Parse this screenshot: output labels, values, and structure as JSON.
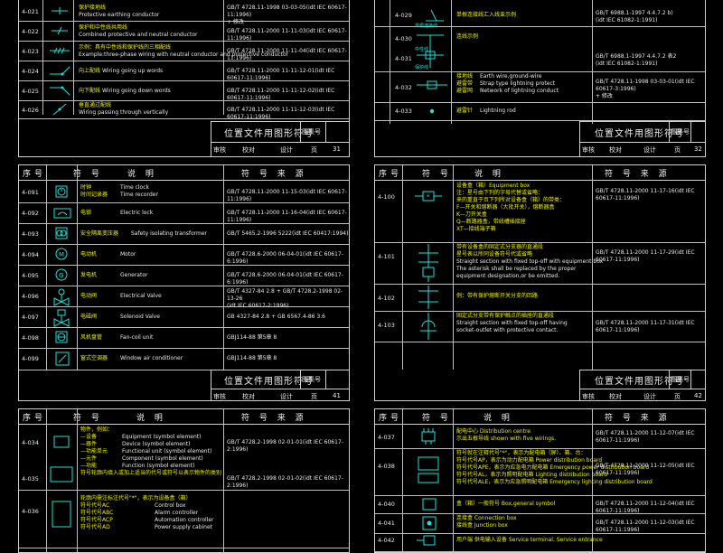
{
  "sheets": {
    "s31": {
      "rows": [
        {
          "num": "4-021",
          "cn": "保护接地线",
          "en": "Protective earthing conductor",
          "src": "GB/T 4728.11-1998 03-03-05(idt IEC 60617-11:1996)",
          "src2": "+ 修改"
        },
        {
          "num": "4-022",
          "cn": "保护和中性线共用线",
          "en": "Combined protective and neutral conductor",
          "src": "GB/T 4728.11-2000 11-11-03(idt IEC 60617-11:1996)"
        },
        {
          "num": "4-023",
          "cn": "示例：具有中性线和保护线的三相配线",
          "en": "Example:three-phase wiring with neutral conductor and protective conductor",
          "src": "GB/T 4728.11-2000 11-11-04(idt IEC 60617-11:1996)"
        },
        {
          "num": "4-024",
          "cn": "向上配线",
          "en": "Wiring going up words",
          "src": "GB/T 4728.11-2000 11-11-12-01(idt IEC 60617-11:1996)"
        },
        {
          "num": "4-025",
          "cn": "向下配线",
          "en": "Wiring going down words",
          "src": "GB/T 4728.11-2000 11-11-12-02(idt IEC 60617-11:1996)"
        },
        {
          "num": "4-026",
          "cn": "垂直通过配线",
          "en": "Wiring passing through vertically",
          "src": "GB/T 4728.11-2000 11-11-12-03(idt IEC 60617-11:1996)"
        }
      ],
      "title": "位置文件用图形符号",
      "label": "图集号",
      "page": "31",
      "b1": "审核",
      "b2": "校对",
      "b3": "设计",
      "b4": "页"
    },
    "s32": {
      "rows": [
        {
          "num": "4-029",
          "cn": "单根连接线汇入线束示例",
          "en": "",
          "src": "GB/T 6988.1-1997 4.4.7.2 b)",
          "src2": "(idt IEC 61082-1:1991)"
        },
        {
          "num": "4-030",
          "cn": "",
          "en": "",
          "src": ""
        },
        {
          "num": "4-031",
          "cn": "",
          "en": "",
          "src": "GB/T 6988.1-1997 4.4.7.2 表2",
          "src2": "(idt IEC 61082-1:1991)"
        },
        {
          "num": "4-032",
          "cn": "接地线",
          "en": "Earth wire,ground-wire",
          "cn2": "避雷带",
          "en2": "Strap type lightning protect",
          "cn3": "避雷网",
          "en3": "Network of lightning conduct",
          "src": "GB/T 4728.11-1998 03-03-01(idt IEC 60617-3:1996)",
          "src2": "+ 修改"
        },
        {
          "num": "4-033",
          "cn": "避雷针",
          "en": "Lightning rod",
          "src": ""
        }
      ],
      "label_a": "单根连接线",
      "label_b": "连线示例",
      "label_c": "中性线",
      "label_d": "保护线",
      "title": "位置文件用图形符号",
      "label": "图集号",
      "page": "32",
      "b1": "审核",
      "b2": "校对",
      "b3": "设计",
      "b4": "页"
    },
    "s41": {
      "header": {
        "c1": "序号",
        "c2": "符 号",
        "c3": "说 明",
        "c4": "符 号 来 源"
      },
      "rows": [
        {
          "num": "4-091",
          "cn": "时钟",
          "en": "Time clock",
          "cn2": "时间记录器",
          "en2": "Time recorder",
          "src": "GB/T 4728.11-2000 11-15-03(idt IEC 60617-11:1996)"
        },
        {
          "num": "4-092",
          "cn": "电锁",
          "en": "Electric lock",
          "src": "GB/T 4728.11-2000 11-16-04(idt IEC 60617-11:1996)"
        },
        {
          "num": "4-093",
          "cn": "安全隔离变压器",
          "en": "Safety isolating transformer",
          "src": "GB/T 5465.2-1996 5222(idt IEC 60417:1994)"
        },
        {
          "num": "4-094",
          "cn": "电动机",
          "en": "Motor",
          "src": "GB/T 4728.6-2000 06-04-01(idt IEC 60617-6:1996)"
        },
        {
          "num": "4-095",
          "cn": "发电机",
          "en": "Generator",
          "src": "GB/T 4728.6-2000 06-04-01(idt IEC 60617-6:1996)"
        },
        {
          "num": "4-096",
          "cn": "电动阀",
          "en": "Electrical Valve",
          "src": "GB/T 4327-84 2.8 + GB/T 4728.2-1998 02-13-26",
          "src2": "(idt IEC 60617-2:1996)"
        },
        {
          "num": "4-097",
          "cn": "电磁阀",
          "en": "Solenoid Valve",
          "src": "GB 4327-84 2.8 + GB 6567.4-86 3.6"
        },
        {
          "num": "4-098",
          "cn": "风机盘管",
          "en": "Fan-coil unit",
          "src": "GBJ114-88 第5章 8"
        },
        {
          "num": "4-099",
          "cn": "窗式空调器",
          "en": "Window air conditioner",
          "src": "GBJ114-88 第5章 8"
        }
      ],
      "title": "位置文件用图形符号",
      "label": "图集号",
      "page": "41",
      "b1": "审核",
      "b2": "校对",
      "b3": "设计",
      "b4": "页"
    },
    "s42": {
      "header": {
        "c1": "序号",
        "c2": "符 号",
        "c3": "说 明",
        "c4": "符 号 来 源"
      },
      "rows": [
        {
          "num": "4-100",
          "lines": [
            "设备盒（箱）Equipment box",
            "注：星号由下列的字母代替或省略：",
            "来的重直于页下列所对设备盒（箱）的带类：",
            "F—开关和熔断器（大批开关），熔断器盒",
            "K—刀开关盒",
            "Q—断路器盒，带线槽插接座",
            "XT—接线端子箱"
          ],
          "src": "GB/T 4728.11-2000 11-17-16(idt IEC 60617-11:1996)"
        },
        {
          "num": "4-101",
          "lines": [
            "带有设备盒的固定式分支器的直通段",
            "星号表以所同设备符号代或省略",
            "Straight section with fixed top-off with equipment box",
            "The asterisk shall be replaced by the proper",
            "equipment designation,or be omitted."
          ],
          "src": "GB/T 4728.11-2000 11-17-29(idt IEC 60617-11:1996)"
        },
        {
          "num": "4-102",
          "lines": [
            "例：带有保护熔断开关分支的回路"
          ],
          "src": ""
        },
        {
          "num": "4-103",
          "lines": [
            "固定式分支带有保护触点的插座的直通段",
            "Straight section with fixed top-off having",
            "socket-outlet with protective contact."
          ],
          "src": "GB/T 4728.11-2000 11-17-31(idt IEC 60617-11:1996)"
        }
      ],
      "title": "位置文件用图形符号",
      "label": "图集号",
      "page": "42",
      "b1": "审核",
      "b2": "校对",
      "b3": "设计",
      "b4": "页"
    },
    "s51": {
      "header": {
        "c1": "序号",
        "c2": "符 号",
        "c3": "说 明",
        "c4": "符 号 来 源"
      },
      "rows": [
        {
          "num": "4-034",
          "lines": [
            "物件，例如：",
            "—设备",
            "—器件",
            "—功能单元",
            "—元件",
            "—功能"
          ],
          "en": [
            "",
            "Equipment (symbol element)",
            "Device (symbol element)",
            "Functional unit (symbol element)",
            "Component (symbol element)",
            "Function (symbol element)"
          ],
          "tail": "符号轮廓内填入或加上适当的代号或符号以表示物件的类别",
          "src": "GB/T 4728.2-1998 02-01-01(idt IEC 60617-2:1996)"
        },
        {
          "num": "4-035",
          "lines": [],
          "src": "GB/T 4728.2-1998 02-01-02(idt IEC 60617-2:1996)"
        },
        {
          "num": "4-036",
          "lines": [
            "轮廓内需注标注代号\"*\"，表示为设备盒（箱）",
            "符号代号AC",
            "符号代号ABC",
            "符号代号ACP",
            "符号代号AD"
          ],
          "en": [
            "",
            "Control box",
            "Alarm controller",
            "Automation controller",
            "Power supply cabinet"
          ],
          "src": ""
        }
      ]
    },
    "s52": {
      "header": {
        "c1": "序号",
        "c2": "符 号",
        "c3": "说 明",
        "c4": "符 号 来 源"
      },
      "rows": [
        {
          "num": "4-037",
          "lines": [
            "配电中心 Distribution centre",
            "示出五根导线 shown with five wirings."
          ],
          "src": "GB/T 4728.11-2000 11-12-07(idt IEC 60617-11:1996)"
        },
        {
          "num": "4-038",
          "lines": [
            "符号就在注释代号\"*\"，表示为配电箱（屏）、箱、台：",
            "符号代号AP，表示为动力配电箱 Power distribution board",
            "符号代号APE，表示为应急电力配电箱 Emergency power distribution board",
            "符号代号AL，表示为照明配电箱 Lighting distribution board",
            "符号代号ALE，表示为应急照明配电箱 Emergency lighting distribution board"
          ],
          "src": "GB/T 4728.11-2000 11-12-05(idt IEC 60617-11:1996)"
        },
        {
          "num": "4-040",
          "lines": [
            "盒（箱）一般符号 Box,general symbol"
          ],
          "src": "GB/T 4728.11-2000 11-12-04(idt IEC 60617-11:1996)"
        },
        {
          "num": "4-041",
          "lines": [
            "连接盒 Connection box",
            "接线盒 Junction box"
          ],
          "src": "GB/T 4728.11-2000 11-12-03(idt IEC 60617-11:1996)"
        },
        {
          "num": "4-042",
          "lines": [
            "用户端 供电输入设备 Service terminal, Service entrance"
          ],
          "src": ""
        }
      ]
    }
  }
}
